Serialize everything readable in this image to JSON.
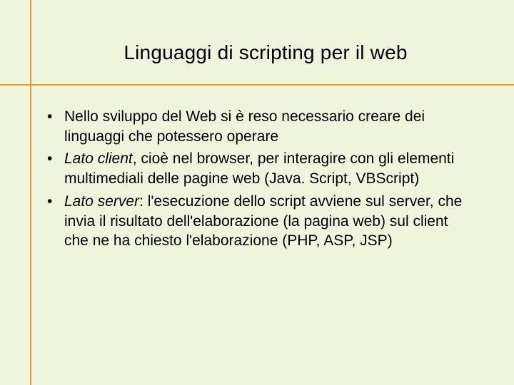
{
  "title": "Linguaggi di scripting per il web",
  "bullets": [
    {
      "em": "",
      "rest": "Nello sviluppo del Web si è reso necessario creare dei linguaggi che potessero operare"
    },
    {
      "em": "Lato client",
      "rest": ", cioè nel browser, per interagire con gli elementi multimediali delle pagine web (Java. Script, VBScript)"
    },
    {
      "em": "Lato server",
      "rest": ": l'esecuzione dello script avviene sul server, che invia il risultato dell'elaborazione (la pagina web) sul client che ne ha chiesto l'elaborazione (PHP, ASP, JSP)"
    }
  ]
}
